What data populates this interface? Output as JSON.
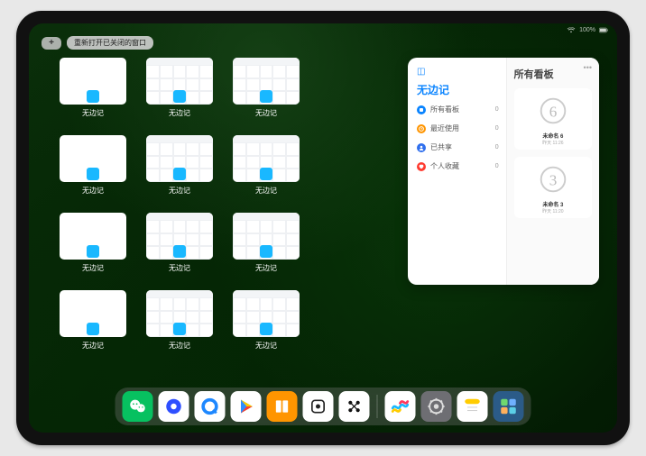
{
  "status": {
    "battery": "100%"
  },
  "toolbar": {
    "plus": "+",
    "reopen_label": "重新打开已关闭的窗口"
  },
  "app_label": "无边记",
  "windows": [
    {
      "type": "blank"
    },
    {
      "type": "grid"
    },
    {
      "type": "grid"
    },
    null,
    {
      "type": "blank"
    },
    {
      "type": "grid"
    },
    {
      "type": "grid"
    },
    null,
    {
      "type": "blank"
    },
    {
      "type": "grid"
    },
    {
      "type": "grid"
    },
    null,
    {
      "type": "blank"
    },
    {
      "type": "grid"
    },
    {
      "type": "grid"
    }
  ],
  "panel": {
    "left_title": "无边记",
    "categories": [
      {
        "color": "#0a84ff",
        "name": "所有看板",
        "count": 0,
        "icon": "square"
      },
      {
        "color": "#ff9500",
        "name": "最近使用",
        "count": 0,
        "icon": "clock"
      },
      {
        "color": "#2f6fed",
        "name": "已共享",
        "count": 0,
        "icon": "person"
      },
      {
        "color": "#ff3b30",
        "name": "个人收藏",
        "count": 0,
        "icon": "heart"
      }
    ],
    "right_title": "所有看板",
    "boards": [
      {
        "glyph": "6",
        "name": "未命名 6",
        "sub": "昨天 11:26"
      },
      {
        "glyph": "3",
        "name": "未命名 3",
        "sub": "昨天 11:20"
      }
    ]
  },
  "dock": [
    {
      "bg": "#07c160",
      "name": "wechat"
    },
    {
      "bg": "#ffffff",
      "name": "browser-circle"
    },
    {
      "bg": "#ffffff",
      "name": "q-browser"
    },
    {
      "bg": "#ffffff",
      "name": "play"
    },
    {
      "bg": "#ff9500",
      "name": "books"
    },
    {
      "bg": "#ffffff",
      "name": "dice"
    },
    {
      "bg": "#ffffff",
      "name": "dots"
    },
    {
      "bg": "#ffffff",
      "name": "freeform"
    },
    {
      "bg": "#6e6e73",
      "name": "settings"
    },
    {
      "bg": "#ffffff",
      "name": "notes"
    },
    {
      "bg": "#2b5b88",
      "name": "app-library"
    }
  ]
}
